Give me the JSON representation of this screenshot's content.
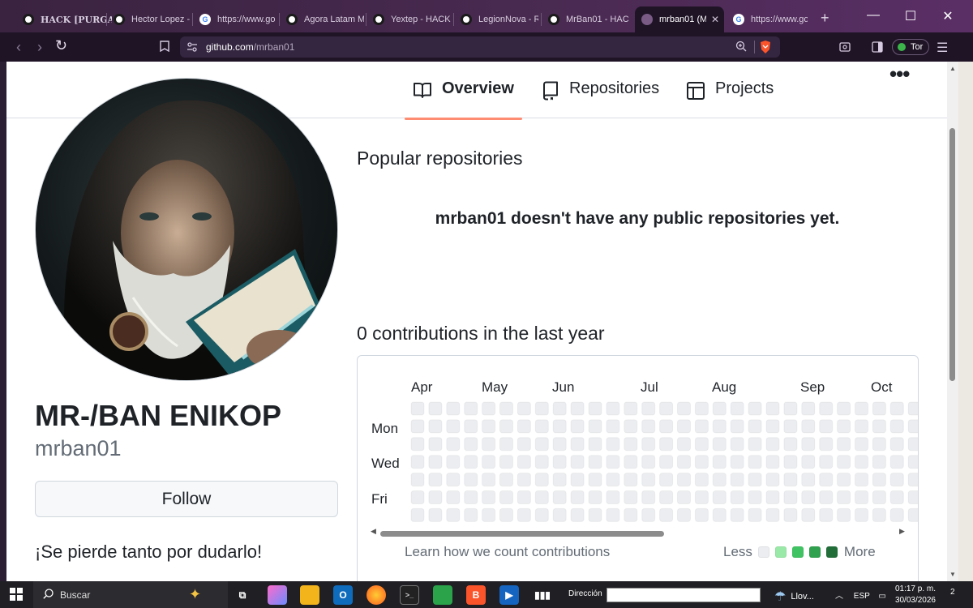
{
  "browser": {
    "tabs": [
      {
        "title": "HACK [PURGA",
        "icon": "github-icon"
      },
      {
        "title": "Hector Lopez -",
        "icon": "github-icon"
      },
      {
        "title": "https://www.go",
        "icon": "google-icon"
      },
      {
        "title": "Agora Latam M",
        "icon": "github-icon"
      },
      {
        "title": "Yextep - HACK",
        "icon": "github-icon"
      },
      {
        "title": "LegionNova - R",
        "icon": "github-icon"
      },
      {
        "title": "MrBan01 - HAC",
        "icon": "github-icon"
      },
      {
        "title": "mrban01 (M",
        "icon": "github-icon",
        "active": true
      },
      {
        "title": "https://www.go",
        "icon": "google-icon"
      }
    ],
    "new_tab": "+",
    "window_controls": {
      "minimize": "—",
      "maximize": "☐",
      "close": "✕"
    },
    "url": {
      "host": "github.com",
      "path": "/mrban01"
    },
    "tor_label": "Tor"
  },
  "nav": {
    "tabs": [
      {
        "label": "Overview",
        "icon": "book-icon",
        "selected": true
      },
      {
        "label": "Repositories",
        "icon": "repo-icon"
      },
      {
        "label": "Projects",
        "icon": "table-icon"
      }
    ],
    "more": "•••"
  },
  "profile": {
    "name": "MR-/BAN ENIKOP",
    "login": "mrban01",
    "follow_label": "Follow",
    "bio": "¡Se pierde tanto por dudarlo!"
  },
  "main": {
    "popular_heading": "Popular repositories",
    "no_repos": "mrban01 doesn't have any public repositories yet.",
    "contrib_heading": "0 contributions in the last year"
  },
  "contrib_graph": {
    "months": [
      "Apr",
      "May",
      "Jun",
      "Jul",
      "Aug",
      "Sep",
      "Oct"
    ],
    "day_labels": [
      "Mon",
      "Wed",
      "Fri"
    ],
    "contribution_count": 0,
    "empty_color": "#ebedf0",
    "learn_link": "Learn how we count contributions",
    "legend_less": "Less",
    "legend_more": "More",
    "legend_colors": [
      "#ebedf0",
      "#9be9a8",
      "#40c463",
      "#30a14e",
      "#216e39"
    ]
  },
  "taskbar": {
    "search_placeholder": "Buscar",
    "address_label": "Dirección",
    "weather": "Llov...",
    "language": "ESP",
    "time": "01:17 p. m.",
    "date": "30/03/2026",
    "notifications": "2"
  },
  "colors": {
    "accent_underline": "#fd8c73",
    "text_primary": "#1f2328",
    "text_muted": "#636c76",
    "chrome_bg": "#1f1426"
  }
}
